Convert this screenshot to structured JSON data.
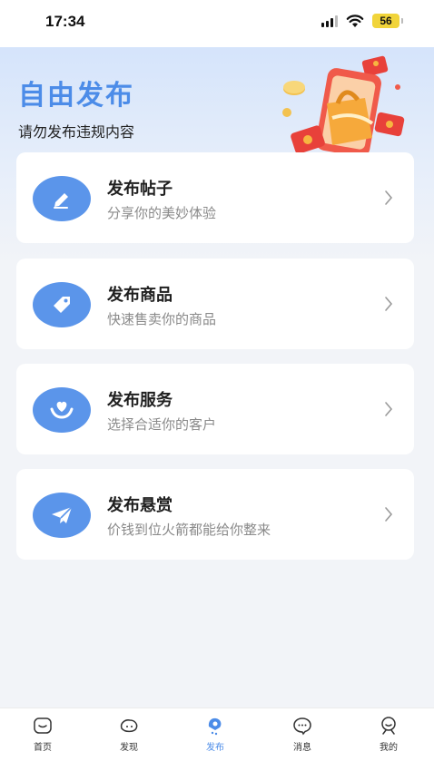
{
  "status_bar": {
    "time": "17:34",
    "battery": "56"
  },
  "header": {
    "title": "自由发布",
    "subtitle": "请勿发布违规内容"
  },
  "cards": [
    {
      "title": "发布帖子",
      "desc": "分享你的美妙体验",
      "icon": "pencil-icon"
    },
    {
      "title": "发布商品",
      "desc": "快速售卖你的商品",
      "icon": "tag-icon"
    },
    {
      "title": "发布服务",
      "desc": "选择合适你的客户",
      "icon": "heart-hands-icon"
    },
    {
      "title": "发布悬赏",
      "desc": "价钱到位火箭都能给你整来",
      "icon": "paper-plane-icon"
    }
  ],
  "bottom_nav": [
    {
      "label": "首页",
      "icon": "home-icon",
      "active": false
    },
    {
      "label": "发现",
      "icon": "discover-icon",
      "active": false
    },
    {
      "label": "发布",
      "icon": "publish-icon",
      "active": true
    },
    {
      "label": "消息",
      "icon": "message-icon",
      "active": false
    },
    {
      "label": "我的",
      "icon": "profile-icon",
      "active": false
    }
  ],
  "colors": {
    "accent": "#4c8ce8",
    "icon_bg": "#5b95ea",
    "card_bg": "#ffffff",
    "page_bg": "#f2f4f8"
  }
}
